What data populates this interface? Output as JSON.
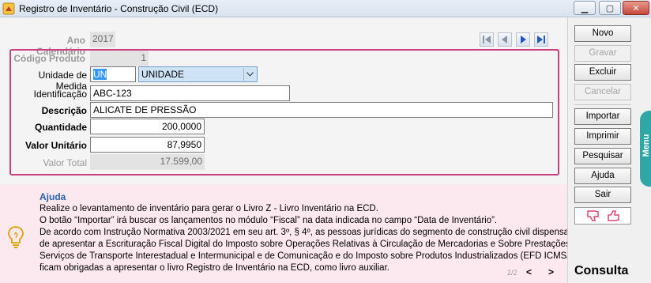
{
  "window": {
    "title": "Registro de Inventário - Construção Civil (ECD)"
  },
  "form": {
    "ano_calendario": {
      "label": "Ano Calendário",
      "value": "2017"
    },
    "codigo_produto": {
      "label": "Código Produto",
      "value": "1"
    },
    "unidade_medida": {
      "label": "Unidade de Medida",
      "code": "UN",
      "selected": "UNIDADE"
    },
    "identificacao": {
      "label": "Identificação",
      "value": "ABC-123"
    },
    "descricao": {
      "label": "Descrição",
      "value": "ALICATE DE PRESSÃO"
    },
    "quantidade": {
      "label": "Quantidade",
      "value": "200,0000"
    },
    "valor_unitario": {
      "label": "Valor Unitário",
      "value": "87,9950"
    },
    "valor_total": {
      "label": "Valor Total",
      "value": "17.599,00"
    }
  },
  "help": {
    "title": "Ajuda",
    "lines": [
      "Realize o levantamento de inventário para gerar o Livro Z - Livro Inventário na ECD.",
      "O botão “Importar” irá buscar os lançamentos no módulo “Fiscal” na data indicada no campo “Data de Inventário”.",
      "De acordo com Instrução Normativa 2003/2021 em seu art. 3º, § 4º, as pessoas jurídicas do segmento de construção civil dispensadas",
      "de apresentar a Escrituração Fiscal Digital do Imposto sobre Operações Relativas à Circulação de Mercadorias e Sobre Prestações de",
      "Serviços de Transporte Interestadual e Intermunicipal e de Comunicação e do Imposto sobre Produtos Industrializados (EFD ICMS/IPI)",
      "ficam obrigadas a apresentar o livro Registro de Inventário na ECD, como livro auxiliar."
    ],
    "page": "2/2",
    "prev": "<",
    "next": ">"
  },
  "sidebar": {
    "novo": "Novo",
    "gravar": "Gravar",
    "excluir": "Excluir",
    "cancelar": "Cancelar",
    "importar": "Importar",
    "imprimir": "Imprimir",
    "pesquisar": "Pesquisar",
    "ajuda": "Ajuda",
    "sair": "Sair",
    "menu_tab": "Menu",
    "footer": "Consulta"
  },
  "colors": {
    "frame_border": "#c8417c",
    "help_bg": "#fbe9ef",
    "help_title": "#2a62a8",
    "menu_tab": "#2ea7a6",
    "thumb_icon": "#d9476f"
  },
  "icons": [
    "app-icon",
    "first-record-icon",
    "prev-record-icon",
    "next-record-icon",
    "last-record-icon",
    "dropdown-arrow-icon",
    "lightbulb-icon",
    "thumbs-down-icon",
    "thumbs-up-icon",
    "minimize-icon",
    "maximize-icon",
    "close-icon"
  ]
}
